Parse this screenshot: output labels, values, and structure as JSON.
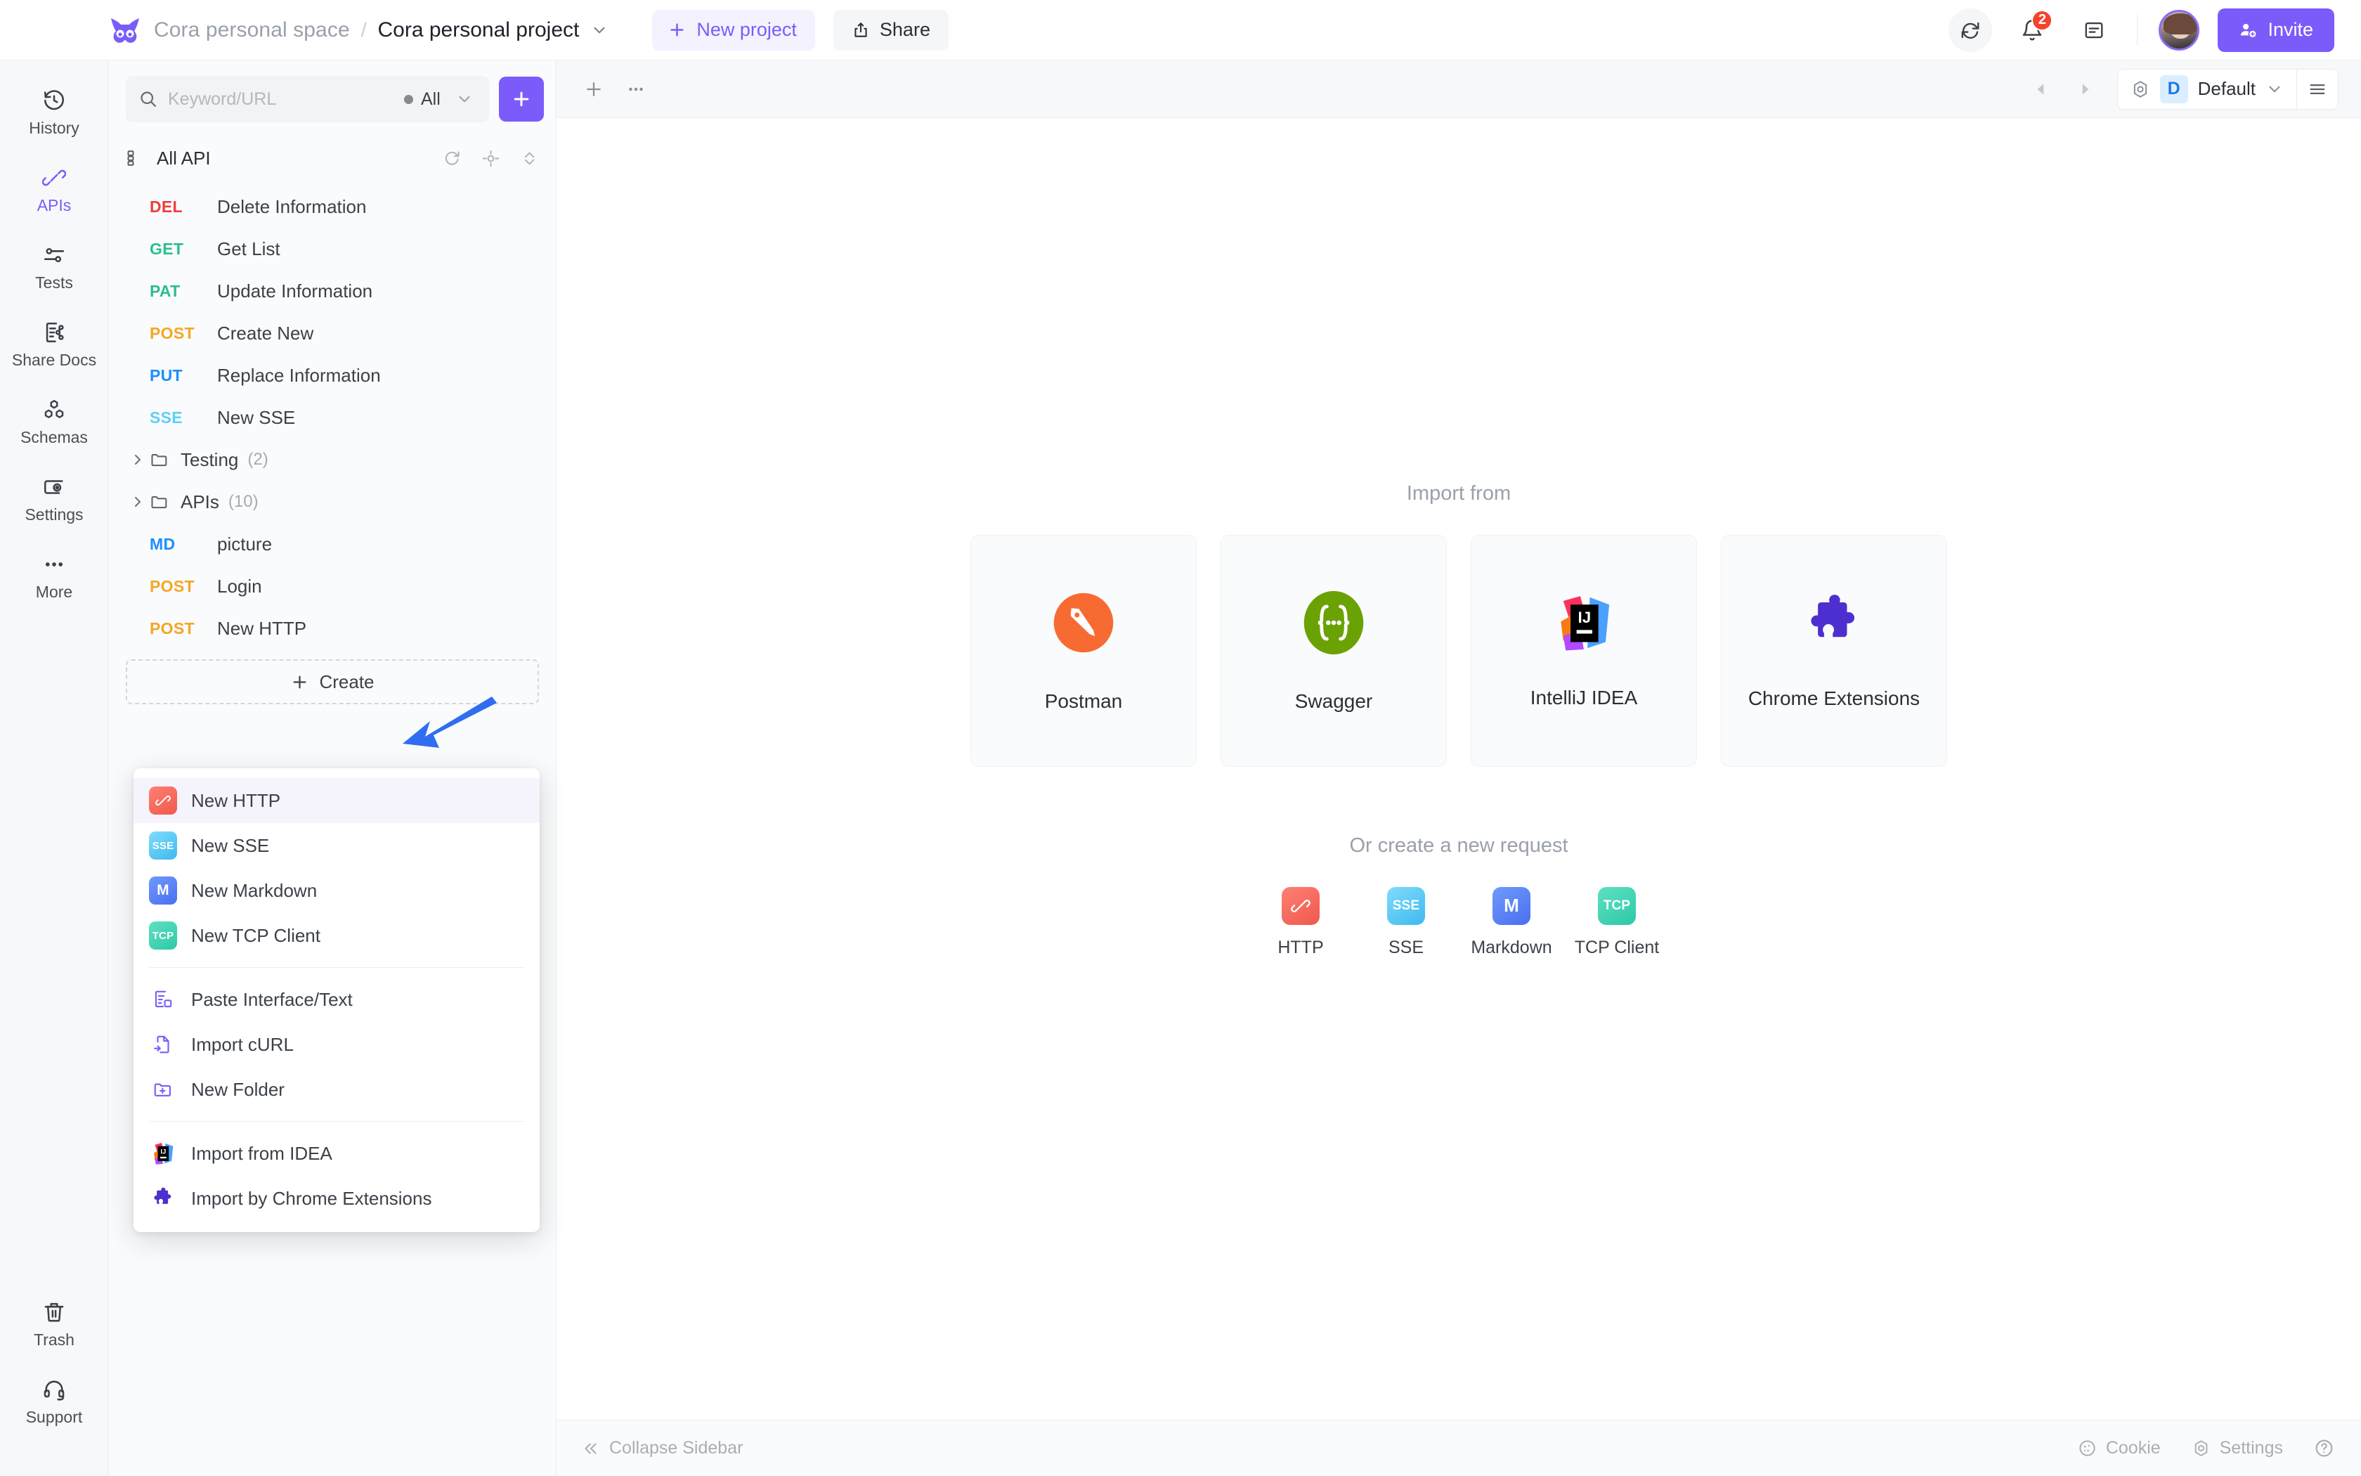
{
  "header": {
    "logo_icon": "owl-logo-icon",
    "space_name": "Cora personal space",
    "breadcrumb_separator": "/",
    "project_name": "Cora personal project",
    "new_project_label": "New project",
    "share_label": "Share",
    "notification_count": "2",
    "invite_label": "Invite"
  },
  "rail": {
    "items": [
      {
        "label": "History",
        "icon": "history-icon",
        "active": false
      },
      {
        "label": "APIs",
        "icon": "apis-icon",
        "active": true
      },
      {
        "label": "Tests",
        "icon": "tests-icon",
        "active": false
      },
      {
        "label": "Share Docs",
        "icon": "share-docs-icon",
        "active": false
      },
      {
        "label": "Schemas",
        "icon": "schemas-icon",
        "active": false
      },
      {
        "label": "Settings",
        "icon": "settings-icon",
        "active": false
      },
      {
        "label": "More",
        "icon": "more-icon",
        "active": false
      }
    ],
    "bottom": [
      {
        "label": "Trash",
        "icon": "trash-icon"
      },
      {
        "label": "Support",
        "icon": "support-icon"
      }
    ]
  },
  "sidebar": {
    "search": {
      "placeholder": "Keyword/URL",
      "value": "",
      "filter_label": "All"
    },
    "add_button_label": "+",
    "all_api_label": "All API",
    "all_api_actions": [
      "refresh-icon",
      "locate-icon",
      "sort-icon"
    ],
    "items": [
      {
        "method": "DEL",
        "name": "Delete Information",
        "color": "#f03e3e",
        "type": "api"
      },
      {
        "method": "GET",
        "name": "Get List",
        "color": "#2bbd8e",
        "type": "api"
      },
      {
        "method": "PAT",
        "name": "Update Information",
        "color": "#2bbd8e",
        "type": "api"
      },
      {
        "method": "POST",
        "name": "Create New",
        "color": "#f5a623",
        "type": "api"
      },
      {
        "method": "PUT",
        "name": "Replace Information",
        "color": "#1a8fff",
        "type": "api"
      },
      {
        "method": "SSE",
        "name": "New SSE",
        "color": "#5fd0f5",
        "type": "api"
      },
      {
        "method": "",
        "name": "Testing",
        "count": "(2)",
        "type": "folder"
      },
      {
        "method": "",
        "name": "APIs",
        "count": "(10)",
        "type": "folder"
      },
      {
        "method": "MD",
        "name": "picture",
        "color": "#1a8fff",
        "type": "api"
      },
      {
        "method": "POST",
        "name": "Login",
        "color": "#f5a623",
        "type": "api"
      },
      {
        "method": "POST",
        "name": "New HTTP",
        "color": "#f5a623",
        "type": "api"
      }
    ],
    "create_label": "Create"
  },
  "create_menu": {
    "groups": [
      {
        "items": [
          {
            "label": "New HTTP",
            "icon": "http-square-icon",
            "badge": "",
            "kind": "square",
            "style": "http",
            "highlighted": true
          },
          {
            "label": "New SSE",
            "icon": "sse-square-icon",
            "badge": "SSE",
            "kind": "square",
            "style": "sse",
            "highlighted": false
          },
          {
            "label": "New Markdown",
            "icon": "markdown-square-icon",
            "badge": "M",
            "kind": "square",
            "style": "md",
            "highlighted": false
          },
          {
            "label": "New TCP Client",
            "icon": "tcp-square-icon",
            "badge": "TCP",
            "kind": "square",
            "style": "tcp",
            "highlighted": false
          }
        ]
      },
      {
        "items": [
          {
            "label": "Paste Interface/Text",
            "icon": "paste-interface-icon",
            "kind": "outline"
          },
          {
            "label": "Import cURL",
            "icon": "import-curl-icon",
            "kind": "outline"
          },
          {
            "label": "New Folder",
            "icon": "new-folder-icon",
            "kind": "outline"
          }
        ]
      },
      {
        "items": [
          {
            "label": "Import from IDEA",
            "icon": "intellij-idea-icon",
            "kind": "brand-idea"
          },
          {
            "label": "Import by Chrome Extensions",
            "icon": "chrome-extension-icon",
            "kind": "brand-puzzle"
          }
        ]
      }
    ]
  },
  "main_toolbar": {
    "add_tab_icon": "plus-icon",
    "more_icon": "more-horizontal-icon",
    "prev_icon": "chevron-left-icon",
    "next_icon": "chevron-right-icon",
    "env_gear_icon": "env-gear-icon",
    "env_badge": "D",
    "env_name": "Default",
    "env_caret_icon": "chevron-down-icon",
    "env_list_icon": "list-icon"
  },
  "main": {
    "import_title": "Import from",
    "import_cards": [
      {
        "label": "Postman",
        "icon": "postman-icon"
      },
      {
        "label": "Swagger",
        "icon": "swagger-icon"
      },
      {
        "label": "IntelliJ IDEA",
        "icon": "intellij-idea-icon"
      },
      {
        "label": "Chrome Extensions",
        "icon": "chrome-extension-icon"
      }
    ],
    "or_title": "Or create a new request",
    "quick_items": [
      {
        "label": "HTTP",
        "badge": "",
        "style": "http"
      },
      {
        "label": "SSE",
        "badge": "SSE",
        "style": "sse"
      },
      {
        "label": "Markdown",
        "badge": "M",
        "style": "md"
      },
      {
        "label": "TCP Client",
        "badge": "TCP",
        "style": "tcp"
      }
    ]
  },
  "statusbar": {
    "collapse_label": "Collapse Sidebar",
    "cookie_label": "Cookie",
    "settings_label": "Settings",
    "help_icon": "help-circle-icon"
  },
  "colors": {
    "accent": "#7b5cfa",
    "badge_red": "#f4442e",
    "env_blue": "#1f7ae0"
  }
}
